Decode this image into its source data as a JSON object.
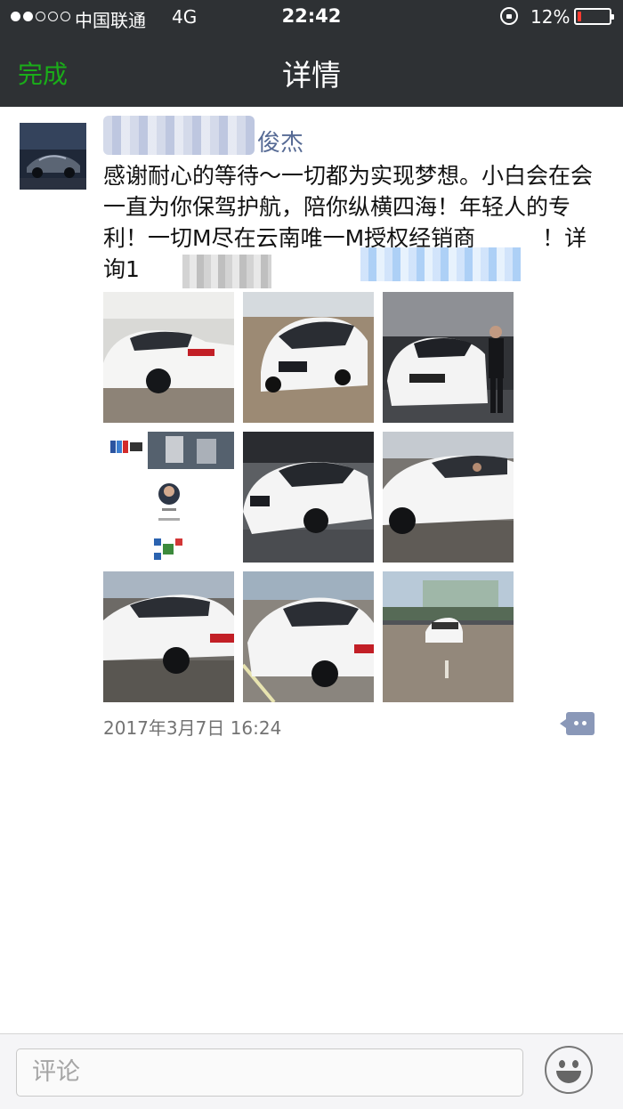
{
  "status_bar": {
    "signal_dots_filled": 2,
    "signal_dots_total": 5,
    "carrier": "中国联通",
    "network": "4G",
    "time": "22:42",
    "battery_percent": "12%",
    "battery_level": 0.12,
    "battery_color": "#ff3b30"
  },
  "nav": {
    "back_label": "完成",
    "title": "详情",
    "accent_color": "#1aad19"
  },
  "post": {
    "author_visible": "俊杰",
    "text": "感谢耐心的等待～一切都为实现梦想。小白会在会一直为你保驾护航，陪你纵横四海！年轻人的专利！一切M尽在云南唯一M授权经销商　　　！详询1",
    "photos": [
      {
        "icon": "white-bmw-m2-rear-photo"
      },
      {
        "icon": "white-bmw-m2-front-photo"
      },
      {
        "icon": "white-bmw-m2-with-person-photo"
      },
      {
        "icon": "business-card-qr-photo"
      },
      {
        "icon": "white-bmw-m2-angle-photo"
      },
      {
        "icon": "white-bmw-m2-side-photo"
      },
      {
        "icon": "white-bmw-m2-rear-side-photo"
      },
      {
        "icon": "white-bmw-m2-parking-photo"
      },
      {
        "icon": "white-bmw-m2-distance-photo"
      }
    ],
    "timestamp": "2017年3月7日 16:24",
    "name_color": "#576b95"
  },
  "comment_bar": {
    "placeholder": "评论"
  }
}
